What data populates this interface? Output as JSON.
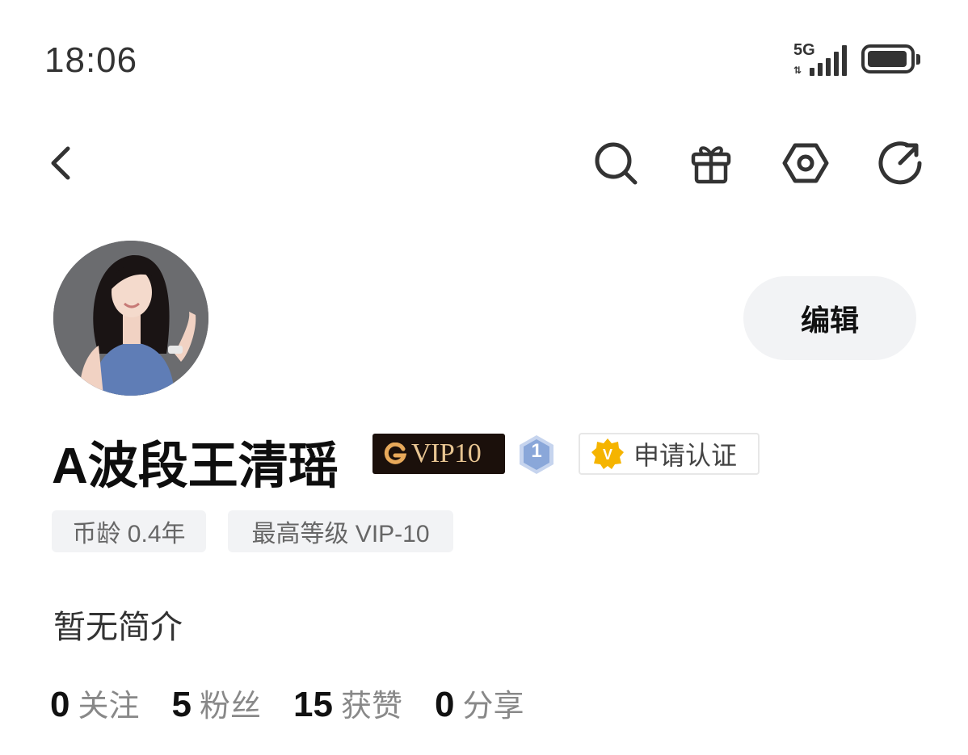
{
  "status_bar": {
    "time": "18:06",
    "network": "5G",
    "signal_bars": 5,
    "battery_icon": "battery-icon"
  },
  "nav": {
    "back_icon": "chevron-left-icon",
    "search_icon": "search-icon",
    "gift_icon": "gift-icon",
    "settings_icon": "settings-hexagon-icon",
    "refresh_icon": "refresh-icon"
  },
  "profile": {
    "edit_label": "编辑",
    "username": "A波段王清瑶",
    "vip_badge": "VIP10",
    "level_badge": "1",
    "verify_label": "申请认证",
    "tags": [
      "币龄 0.4年",
      "最高等级 VIP-10"
    ],
    "bio": "暂无简介",
    "stats": [
      {
        "value": "0",
        "label": "关注"
      },
      {
        "value": "5",
        "label": "粉丝"
      },
      {
        "value": "15",
        "label": "获赞"
      },
      {
        "value": "0",
        "label": "分享"
      }
    ]
  },
  "colors": {
    "vip_bg": "#1b100b",
    "vip_text": "#e8c592",
    "verify_badge": "#f5b400",
    "level_badge": "#8aa7d9",
    "chip_bg": "#f2f3f5"
  }
}
